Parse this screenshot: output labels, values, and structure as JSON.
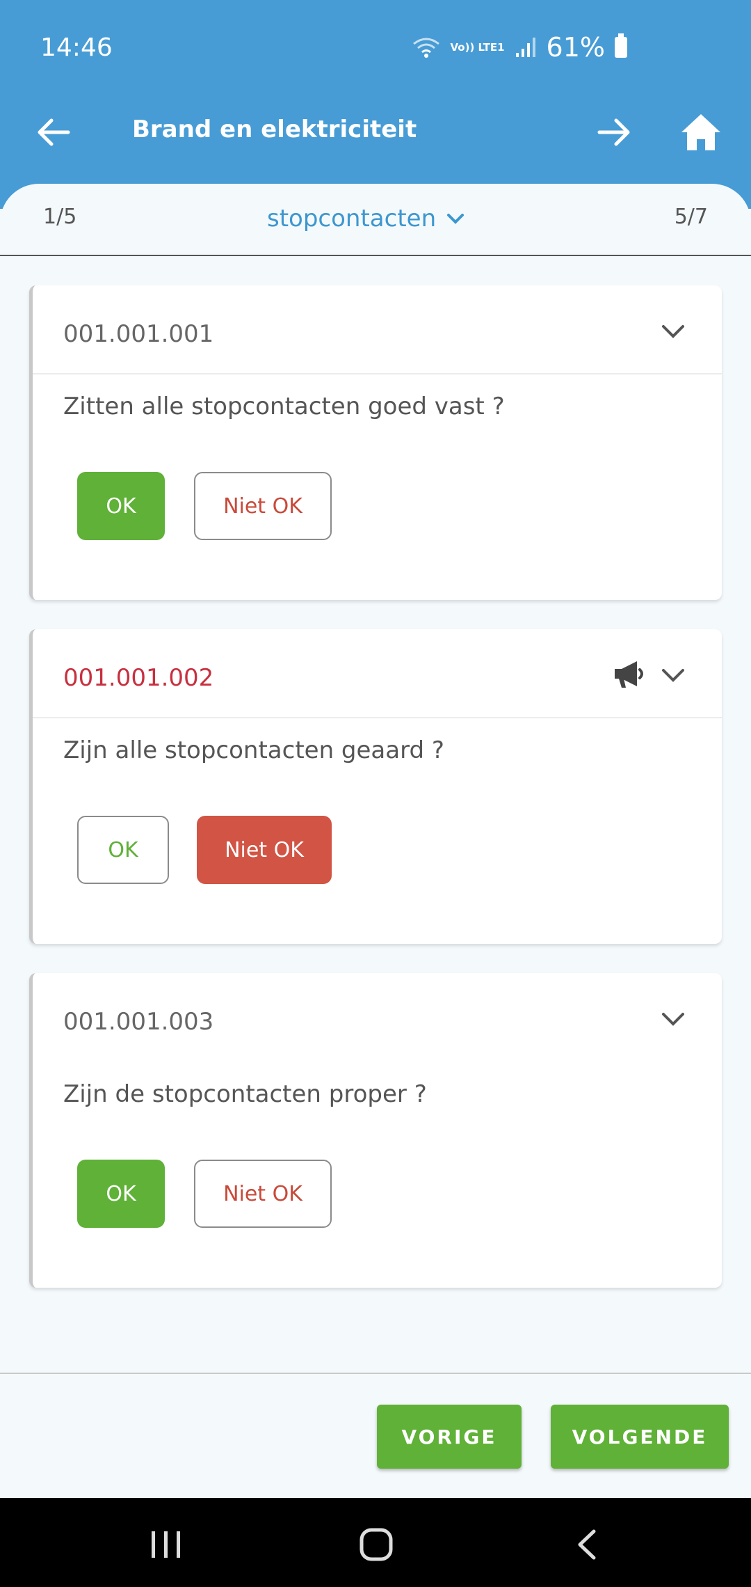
{
  "status_bar": {
    "time": "14:46",
    "network": "Vo)) LTE1",
    "battery_percent": "61%"
  },
  "header": {
    "title": "Brand en elektriciteit",
    "back_icon": "arrow-left-icon",
    "forward_icon": "arrow-right-icon",
    "home_icon": "home-icon"
  },
  "section_bar": {
    "left_counter": "1/5",
    "section_name": "stopcontacten",
    "right_counter": "5/7"
  },
  "items": [
    {
      "code": "001.001.001",
      "question": "Zitten alle stopcontacten goed vast ?",
      "ok_label": "OK",
      "not_ok_label": "Niet OK",
      "selected": "OK"
    },
    {
      "code": "001.001.002",
      "question": "Zijn alle stopcontacten geaard ?",
      "ok_label": "OK",
      "not_ok_label": "Niet OK",
      "selected": "Niet OK",
      "has_announcement_icon": true
    },
    {
      "code": "001.001.003",
      "question": "Zijn de stopcontacten proper ?",
      "ok_label": "OK",
      "not_ok_label": "Niet OK",
      "selected": "OK"
    }
  ],
  "footer": {
    "previous_label": "VORIGE",
    "next_label": "VOLGENDE"
  },
  "colors": {
    "header_blue": "#479cd5",
    "accent_blue": "#3d97cf",
    "ok_green": "#5fb137",
    "not_ok_red": "#d15444",
    "code_red": "#c8303f"
  }
}
